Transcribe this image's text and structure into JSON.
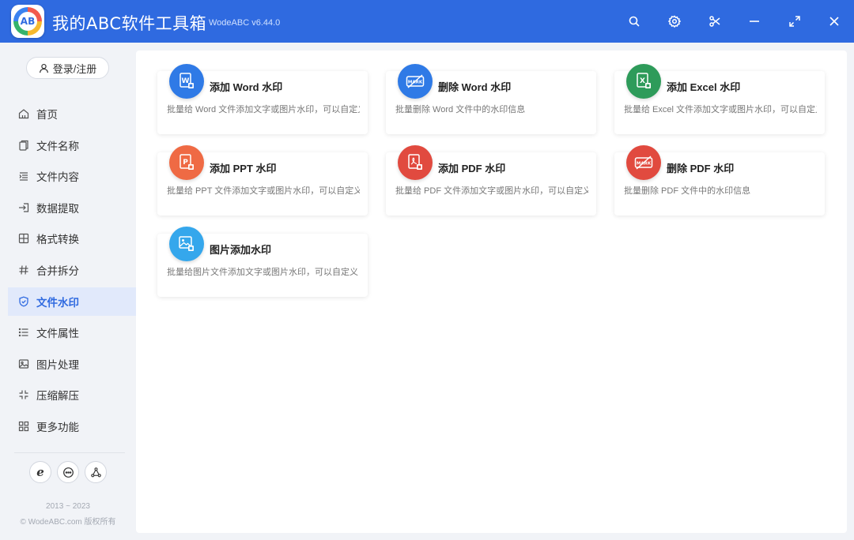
{
  "app": {
    "title": "我的ABC软件工具箱",
    "version": "WodeABC v6.44.0",
    "logo_text": "AB"
  },
  "colors": {
    "brand_blue": "#2f6ae0",
    "word": "#2f7ae6",
    "excel": "#2e9b5a",
    "ppt": "#ef6a44",
    "pdf": "#e14a3f",
    "image": "#35a7ec"
  },
  "window_controls": [
    "search-icon",
    "gear-icon",
    "scissors-icon",
    "minimize-icon",
    "maximize-icon",
    "close-icon"
  ],
  "sidebar": {
    "login_label": "登录/注册",
    "items": [
      {
        "label": "首页",
        "icon": "home-icon"
      },
      {
        "label": "文件名称",
        "icon": "file-icon"
      },
      {
        "label": "文件内容",
        "icon": "content-icon"
      },
      {
        "label": "数据提取",
        "icon": "extract-icon"
      },
      {
        "label": "格式转换",
        "icon": "convert-icon"
      },
      {
        "label": "合并拆分",
        "icon": "hash-icon"
      },
      {
        "label": "文件水印",
        "icon": "shield-icon",
        "active": true
      },
      {
        "label": "文件属性",
        "icon": "list-icon"
      },
      {
        "label": "图片处理",
        "icon": "image-icon"
      },
      {
        "label": "压缩解压",
        "icon": "compress-icon"
      },
      {
        "label": "更多功能",
        "icon": "grid-icon"
      }
    ],
    "social": [
      "ie-icon",
      "chat-icon",
      "share-icon"
    ],
    "copyright_years": "2013 ~ 2023",
    "copyright_text": "© WodeABC.com 版权所有"
  },
  "cards": [
    {
      "title": "添加 Word 水印",
      "desc": "批量给 Word 文件添加文字或图片水印，可以自定义",
      "icon": "word-icon"
    },
    {
      "title": "删除 Word 水印",
      "desc": "批量删除 Word 文件中的水印信息",
      "icon": "word-mark-icon"
    },
    {
      "title": "添加 Excel 水印",
      "desc": "批量给 Excel 文件添加文字或图片水印，可以自定义",
      "icon": "excel-icon"
    },
    {
      "title": "添加 PPT 水印",
      "desc": "批量给 PPT 文件添加文字或图片水印，可以自定义",
      "icon": "ppt-icon"
    },
    {
      "title": "添加 PDF 水印",
      "desc": "批量给 PDF 文件添加文字或图片水印，可以自定义",
      "icon": "pdf-icon"
    },
    {
      "title": "删除 PDF 水印",
      "desc": "批量删除 PDF 文件中的水印信息",
      "icon": "pdf-mark-icon"
    },
    {
      "title": "图片添加水印",
      "desc": "批量给图片文件添加文字或图片水印，可以自定义",
      "icon": "image-watermark-icon"
    }
  ]
}
